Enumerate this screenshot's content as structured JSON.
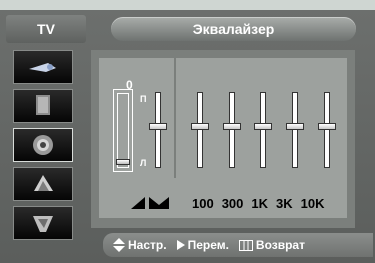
{
  "header": {
    "source_label": "TV",
    "title": "Эквалайзер"
  },
  "sidebar": {
    "items": [
      {
        "name": "picture-icon"
      },
      {
        "name": "speaker-icon"
      },
      {
        "name": "sound-icon"
      },
      {
        "name": "channel-icon"
      },
      {
        "name": "setup-icon"
      }
    ],
    "active_index": 2
  },
  "equalizer": {
    "volume_value_label": "0",
    "balance_left_label": "Л",
    "balance_right_label": "П",
    "frequency_labels": [
      "100",
      "300",
      "1K",
      "3K",
      "10K"
    ],
    "band_levels": [
      0,
      0,
      0,
      0,
      0
    ]
  },
  "footer": {
    "adjust_label": "Настр.",
    "move_label": "Перем.",
    "return_label": "Возврат"
  }
}
